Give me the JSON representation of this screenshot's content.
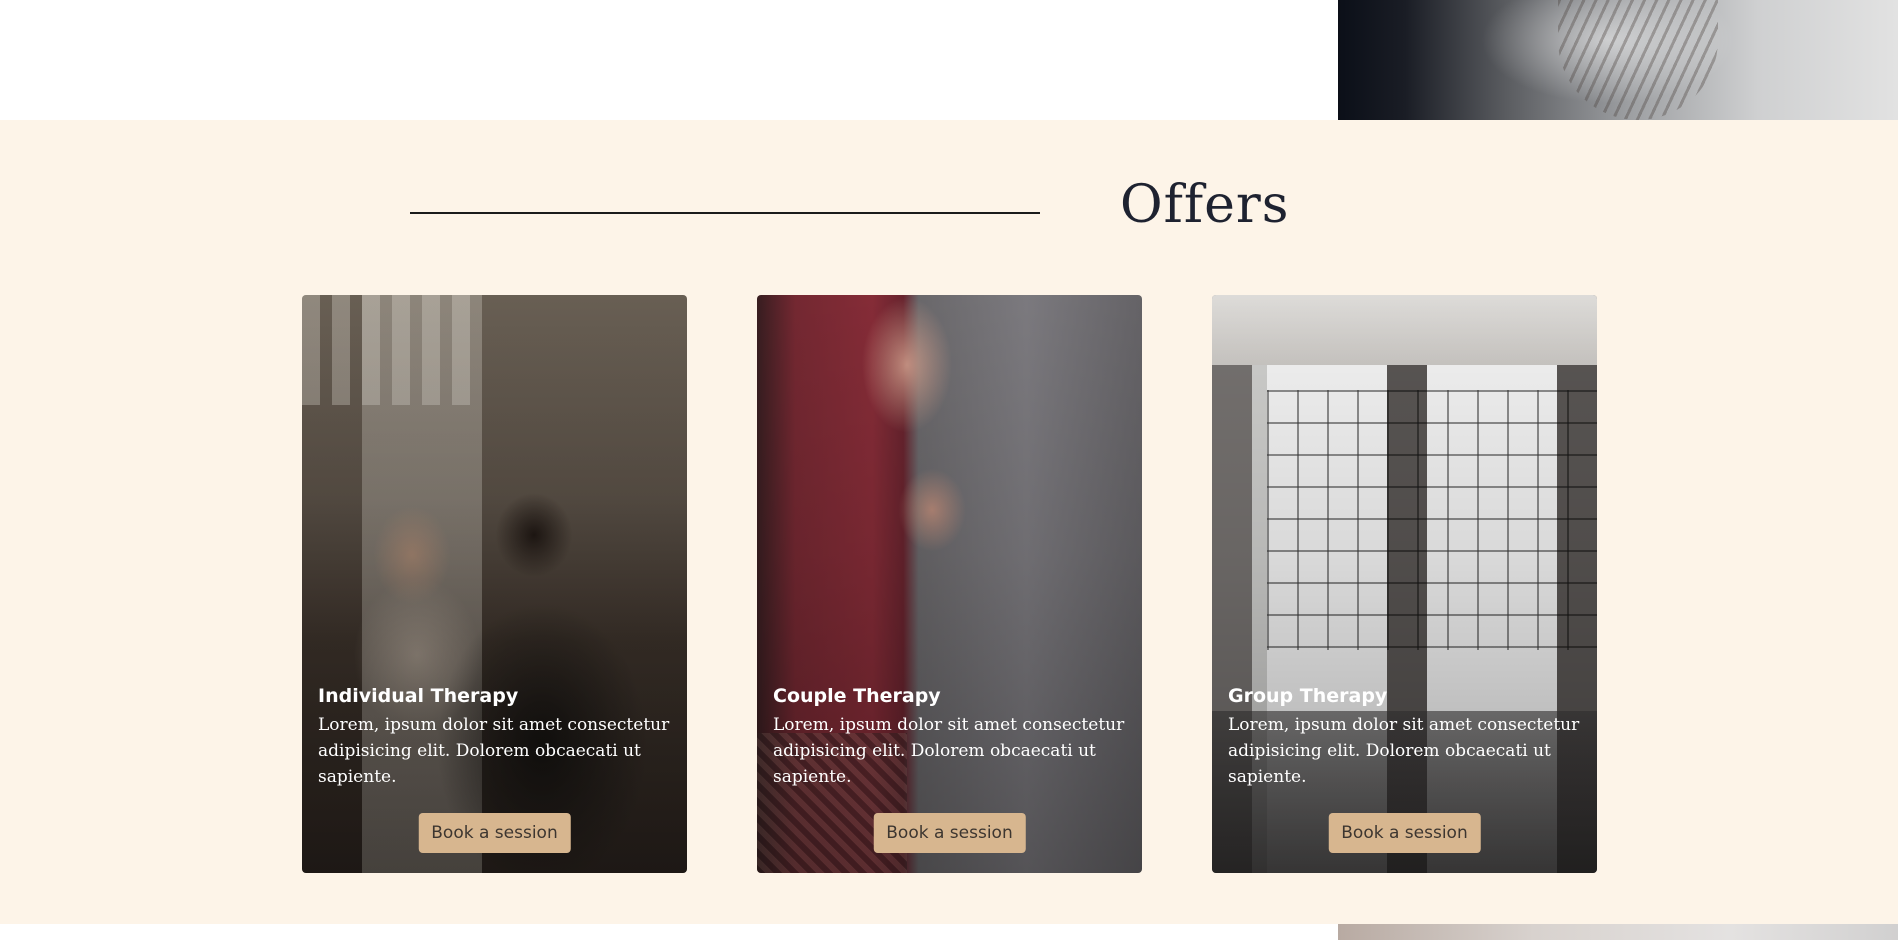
{
  "offers": {
    "title": "Offers",
    "cards": [
      {
        "title": "Individual Therapy",
        "text": "Lorem, ipsum dolor sit amet consectetur adipisicing elit. Dolorem obcaecati ut sapiente.",
        "button_label": "Book a session"
      },
      {
        "title": "Couple Therapy",
        "text": "Lorem, ipsum dolor sit amet consectetur adipisicing elit. Dolorem obcaecati ut sapiente.",
        "button_label": "Book a session"
      },
      {
        "title": "Group Therapy",
        "text": "Lorem, ipsum dolor sit amet consectetur adipisicing elit. Dolorem obcaecati ut sapiente.",
        "button_label": "Book a session"
      }
    ]
  },
  "colors": {
    "section_background": "#fdf4e8",
    "button_background": "#d7b68f",
    "button_text": "#3d3630",
    "title_text": "#1e2230"
  }
}
